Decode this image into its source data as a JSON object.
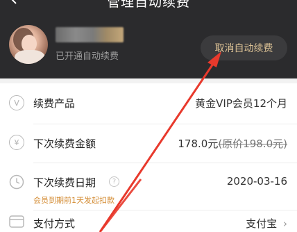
{
  "header": {
    "title": "管理自动续费",
    "status": "已开通自动续费",
    "cancel_label": "取消自动续费"
  },
  "rows": {
    "product": {
      "label": "续费产品",
      "value": "黄金VIP会员12个月",
      "icon": "V"
    },
    "amount": {
      "label": "下次续费金额",
      "value": "178.0元",
      "original": "(原价198.0元)",
      "icon": "¥"
    },
    "date": {
      "label": "下次续费日期",
      "value": "2020-03-16",
      "note": "会员到期前1天发起扣款",
      "help": "?"
    },
    "payment": {
      "label": "支付方式",
      "value": "支付宝",
      "chevron": "›"
    }
  },
  "colors": {
    "header_bg": "#2b2b2d",
    "accent_gold": "#dcc295",
    "note_orange": "#d38b32",
    "annotation_red": "#e8392c"
  }
}
